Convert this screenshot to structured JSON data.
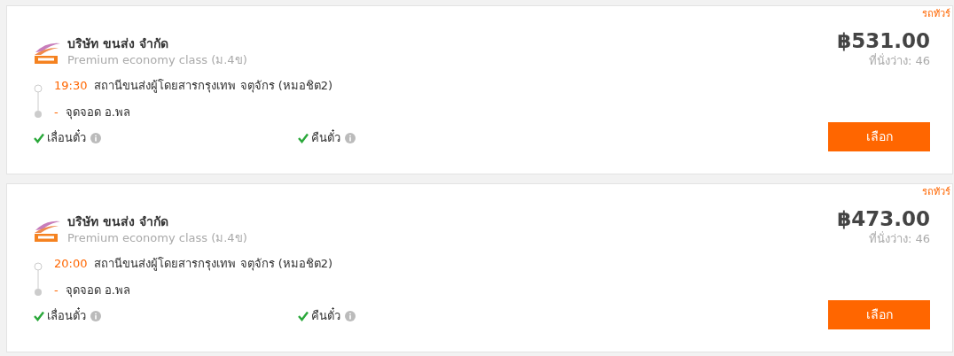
{
  "trips": [
    {
      "tag": "รถทัวร์",
      "company": "บริษัท ขนส่ง จำกัด",
      "class": "Premium economy class (ม.4ข)",
      "departure_time": "19:30",
      "departure_station": "สถานีขนส่งผู้โดยสารกรุงเทพ จตุจักร (หมอชิต2)",
      "arrival_time": "-",
      "arrival_station": "จุดจอด อ.พล",
      "features": [
        "เลื่อนตั๋ว",
        "คืนตั๋ว"
      ],
      "price": "฿531.00",
      "seats": "ที่นั่งว่าง: 46",
      "button": "เลือก"
    },
    {
      "tag": "รถทัวร์",
      "company": "บริษัท ขนส่ง จำกัด",
      "class": "Premium economy class (ม.4ข)",
      "departure_time": "20:00",
      "departure_station": "สถานีขนส่งผู้โดยสารกรุงเทพ จตุจักร (หมอชิต2)",
      "arrival_time": "-",
      "arrival_station": "จุดจอด อ.พล",
      "features": [
        "เลื่อนตั๋ว",
        "คืนตั๋ว"
      ],
      "price": "฿473.00",
      "seats": "ที่นั่งว่าง: 46",
      "button": "เลือก"
    }
  ]
}
